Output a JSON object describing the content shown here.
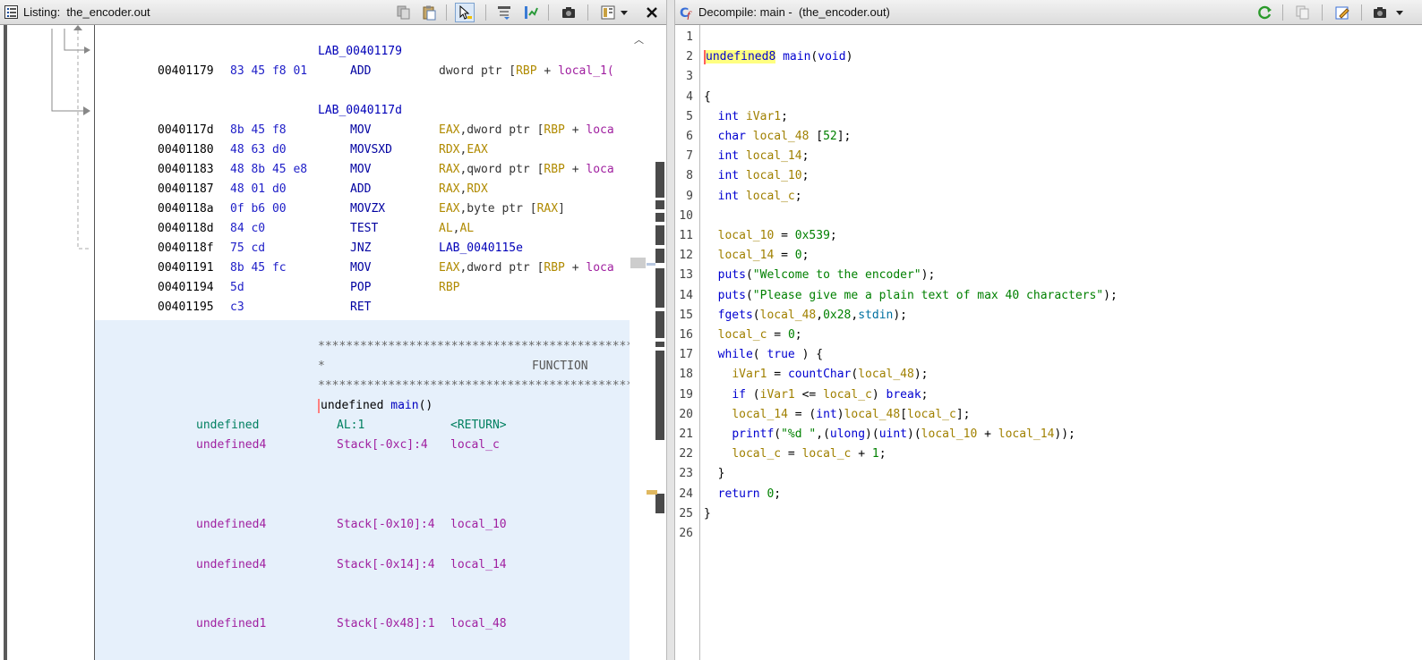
{
  "listing": {
    "title": "Listing:  the_encoder.out",
    "rows": [
      {
        "label": "LAB_00401179"
      },
      {
        "addr": "00401179",
        "bytes": "83 45 f8 01",
        "mnem": "ADD",
        "ops": [
          [
            "dword ptr [",
            "dk"
          ],
          [
            "RBP",
            "reg"
          ],
          [
            " + ",
            "dk"
          ],
          [
            "local_1(",
            "var"
          ]
        ]
      },
      {
        "label": "LAB_0040117d"
      },
      {
        "addr": "0040117d",
        "bytes": "8b 45 f8",
        "mnem": "MOV",
        "ops": [
          [
            "EAX",
            "reg"
          ],
          [
            ",dword ptr [",
            "dk"
          ],
          [
            "RBP",
            "reg"
          ],
          [
            " + ",
            "dk"
          ],
          [
            "loca",
            "var"
          ]
        ]
      },
      {
        "addr": "00401180",
        "bytes": "48 63 d0",
        "mnem": "MOVSXD",
        "ops": [
          [
            "RDX",
            "reg"
          ],
          [
            ",",
            "dk"
          ],
          [
            "EAX",
            "reg"
          ]
        ]
      },
      {
        "addr": "00401183",
        "bytes": "48 8b 45 e8",
        "mnem": "MOV",
        "ops": [
          [
            "RAX",
            "reg"
          ],
          [
            ",qword ptr [",
            "dk"
          ],
          [
            "RBP",
            "reg"
          ],
          [
            " + ",
            "dk"
          ],
          [
            "loca",
            "var"
          ]
        ]
      },
      {
        "addr": "00401187",
        "bytes": "48 01 d0",
        "mnem": "ADD",
        "ops": [
          [
            "RAX",
            "reg"
          ],
          [
            ",",
            "dk"
          ],
          [
            "RDX",
            "reg"
          ]
        ]
      },
      {
        "addr": "0040118a",
        "bytes": "0f b6 00",
        "mnem": "MOVZX",
        "ops": [
          [
            "EAX",
            "reg"
          ],
          [
            ",byte ptr [",
            "dk"
          ],
          [
            "RAX",
            "reg"
          ],
          [
            "]",
            "dk"
          ]
        ]
      },
      {
        "addr": "0040118d",
        "bytes": "84 c0",
        "mnem": "TEST",
        "ops": [
          [
            "AL",
            "reg"
          ],
          [
            ",",
            "dk"
          ],
          [
            "AL",
            "reg"
          ]
        ]
      },
      {
        "addr": "0040118f",
        "bytes": "75 cd",
        "mnem": "JNZ",
        "ops": [
          [
            "LAB_0040115e",
            "lab"
          ]
        ]
      },
      {
        "addr": "00401191",
        "bytes": "8b 45 fc",
        "mnem": "MOV",
        "ops": [
          [
            "EAX",
            "reg"
          ],
          [
            ",dword ptr [",
            "dk"
          ],
          [
            "RBP",
            "reg"
          ],
          [
            " + ",
            "dk"
          ],
          [
            "loca",
            "var"
          ]
        ]
      },
      {
        "addr": "00401194",
        "bytes": "5d",
        "mnem": "POP",
        "ops": [
          [
            "RBP",
            "reg"
          ]
        ]
      },
      {
        "addr": "00401195",
        "bytes": "c3",
        "mnem": "RET",
        "ops": []
      }
    ],
    "banner_stars": "*****************************************************************",
    "banner_mid_left": "*",
    "banner_mid_label": "FUNCTION",
    "signature": "undefined main()",
    "sig_type": "undefined ",
    "sig_name": "main",
    "sig_parens": "()",
    "vars": [
      {
        "type": "undefined",
        "loc": "AL:1",
        "name": "<RETURN>"
      },
      {
        "type": "undefined4",
        "loc": "Stack[-0xc]:4",
        "name": "local_c"
      },
      {
        "type": "undefined4",
        "loc": "Stack[-0x10]:4",
        "name": "local_10"
      },
      {
        "type": "undefined4",
        "loc": "Stack[-0x14]:4",
        "name": "local_14"
      },
      {
        "type": "undefined1",
        "loc": "Stack[-0x48]:1",
        "name": "local_48"
      }
    ]
  },
  "decompile": {
    "title": "Decompile: main -  (the_encoder.out)",
    "line_numbers": [
      "1",
      "2",
      "3",
      "4",
      "5",
      "6",
      "7",
      "8",
      "9",
      "10",
      "11",
      "12",
      "13",
      "14",
      "15",
      "16",
      "17",
      "18",
      "19",
      "20",
      "21",
      "22",
      "23",
      "24",
      "25",
      "26"
    ],
    "lines": [
      [],
      [
        [
          "undefined8",
          "ty hlword"
        ],
        [
          " ",
          "p"
        ],
        [
          "main",
          "fn"
        ],
        [
          "(",
          "p"
        ],
        [
          "void",
          "ty"
        ],
        [
          ")",
          "p"
        ]
      ],
      [],
      [
        [
          "{",
          "p"
        ]
      ],
      [
        [
          "  ",
          "p"
        ],
        [
          "int",
          "ty"
        ],
        [
          " ",
          "p"
        ],
        [
          "iVar1",
          "v"
        ],
        [
          ";",
          "p"
        ]
      ],
      [
        [
          "  ",
          "p"
        ],
        [
          "char",
          "ty"
        ],
        [
          " ",
          "p"
        ],
        [
          "local_48",
          "v"
        ],
        [
          " [",
          "p"
        ],
        [
          "52",
          "num"
        ],
        [
          "];",
          "p"
        ]
      ],
      [
        [
          "  ",
          "p"
        ],
        [
          "int",
          "ty"
        ],
        [
          " ",
          "p"
        ],
        [
          "local_14",
          "v"
        ],
        [
          ";",
          "p"
        ]
      ],
      [
        [
          "  ",
          "p"
        ],
        [
          "int",
          "ty"
        ],
        [
          " ",
          "p"
        ],
        [
          "local_10",
          "v"
        ],
        [
          ";",
          "p"
        ]
      ],
      [
        [
          "  ",
          "p"
        ],
        [
          "int",
          "ty"
        ],
        [
          " ",
          "p"
        ],
        [
          "local_c",
          "v"
        ],
        [
          ";",
          "p"
        ]
      ],
      [],
      [
        [
          "  ",
          "p"
        ],
        [
          "local_10",
          "v"
        ],
        [
          " = ",
          "p"
        ],
        [
          "0x539",
          "num"
        ],
        [
          ";",
          "p"
        ]
      ],
      [
        [
          "  ",
          "p"
        ],
        [
          "local_14",
          "v"
        ],
        [
          " = ",
          "p"
        ],
        [
          "0",
          "num"
        ],
        [
          ";",
          "p"
        ]
      ],
      [
        [
          "  ",
          "p"
        ],
        [
          "puts",
          "fn"
        ],
        [
          "(",
          "p"
        ],
        [
          "\"Welcome to the encoder\"",
          "str"
        ],
        [
          ");",
          "p"
        ]
      ],
      [
        [
          "  ",
          "p"
        ],
        [
          "puts",
          "fn"
        ],
        [
          "(",
          "p"
        ],
        [
          "\"Please give me a plain text of max 40 characters\"",
          "str"
        ],
        [
          ");",
          "p"
        ]
      ],
      [
        [
          "  ",
          "p"
        ],
        [
          "fgets",
          "fn"
        ],
        [
          "(",
          "p"
        ],
        [
          "local_48",
          "v"
        ],
        [
          ",",
          "p"
        ],
        [
          "0x28",
          "num"
        ],
        [
          ",",
          "p"
        ],
        [
          "stdin",
          "gv"
        ],
        [
          ");",
          "p"
        ]
      ],
      [
        [
          "  ",
          "p"
        ],
        [
          "local_c",
          "v"
        ],
        [
          " = ",
          "p"
        ],
        [
          "0",
          "num"
        ],
        [
          ";",
          "p"
        ]
      ],
      [
        [
          "  ",
          "p"
        ],
        [
          "while",
          "k"
        ],
        [
          "( ",
          "p"
        ],
        [
          "true",
          "k"
        ],
        [
          " ) {",
          "p"
        ]
      ],
      [
        [
          "    ",
          "p"
        ],
        [
          "iVar1",
          "v"
        ],
        [
          " = ",
          "p"
        ],
        [
          "countChar",
          "fn"
        ],
        [
          "(",
          "p"
        ],
        [
          "local_48",
          "v"
        ],
        [
          ");",
          "p"
        ]
      ],
      [
        [
          "    ",
          "p"
        ],
        [
          "if",
          "k"
        ],
        [
          " (",
          "p"
        ],
        [
          "iVar1",
          "v"
        ],
        [
          " <= ",
          "p"
        ],
        [
          "local_c",
          "v"
        ],
        [
          ") ",
          "p"
        ],
        [
          "break",
          "k"
        ],
        [
          ";",
          "p"
        ]
      ],
      [
        [
          "    ",
          "p"
        ],
        [
          "local_14",
          "v"
        ],
        [
          " = (",
          "p"
        ],
        [
          "int",
          "ty"
        ],
        [
          ")",
          "p"
        ],
        [
          "local_48",
          "v"
        ],
        [
          "[",
          "p"
        ],
        [
          "local_c",
          "v"
        ],
        [
          "];",
          "p"
        ]
      ],
      [
        [
          "    ",
          "p"
        ],
        [
          "printf",
          "fn"
        ],
        [
          "(",
          "p"
        ],
        [
          "\"%d \"",
          "str"
        ],
        [
          ",(",
          "p"
        ],
        [
          "ulong",
          "ty"
        ],
        [
          ")(",
          "p"
        ],
        [
          "uint",
          "ty"
        ],
        [
          ")(",
          "p"
        ],
        [
          "local_10",
          "v"
        ],
        [
          " + ",
          "p"
        ],
        [
          "local_14",
          "v"
        ],
        [
          "));",
          "p"
        ]
      ],
      [
        [
          "    ",
          "p"
        ],
        [
          "local_c",
          "v"
        ],
        [
          " = ",
          "p"
        ],
        [
          "local_c",
          "v"
        ],
        [
          " + ",
          "p"
        ],
        [
          "1",
          "num"
        ],
        [
          ";",
          "p"
        ]
      ],
      [
        [
          "  }",
          "p"
        ]
      ],
      [
        [
          "  ",
          "p"
        ],
        [
          "return",
          "k"
        ],
        [
          " ",
          "p"
        ],
        [
          "0",
          "num"
        ],
        [
          ";",
          "p"
        ]
      ],
      [
        [
          "}",
          "p"
        ]
      ],
      []
    ]
  },
  "icons": [
    "listing-icon",
    "copy-icon",
    "paste-icon",
    "cursor-select-icon",
    "field-edit-icon",
    "diff-icon",
    "snapshot-icon",
    "layout-icon",
    "dropdown-icon",
    "close-icon",
    "decompile-icon",
    "refresh-icon",
    "copy-icon",
    "edit-icon",
    "snapshot-icon"
  ]
}
